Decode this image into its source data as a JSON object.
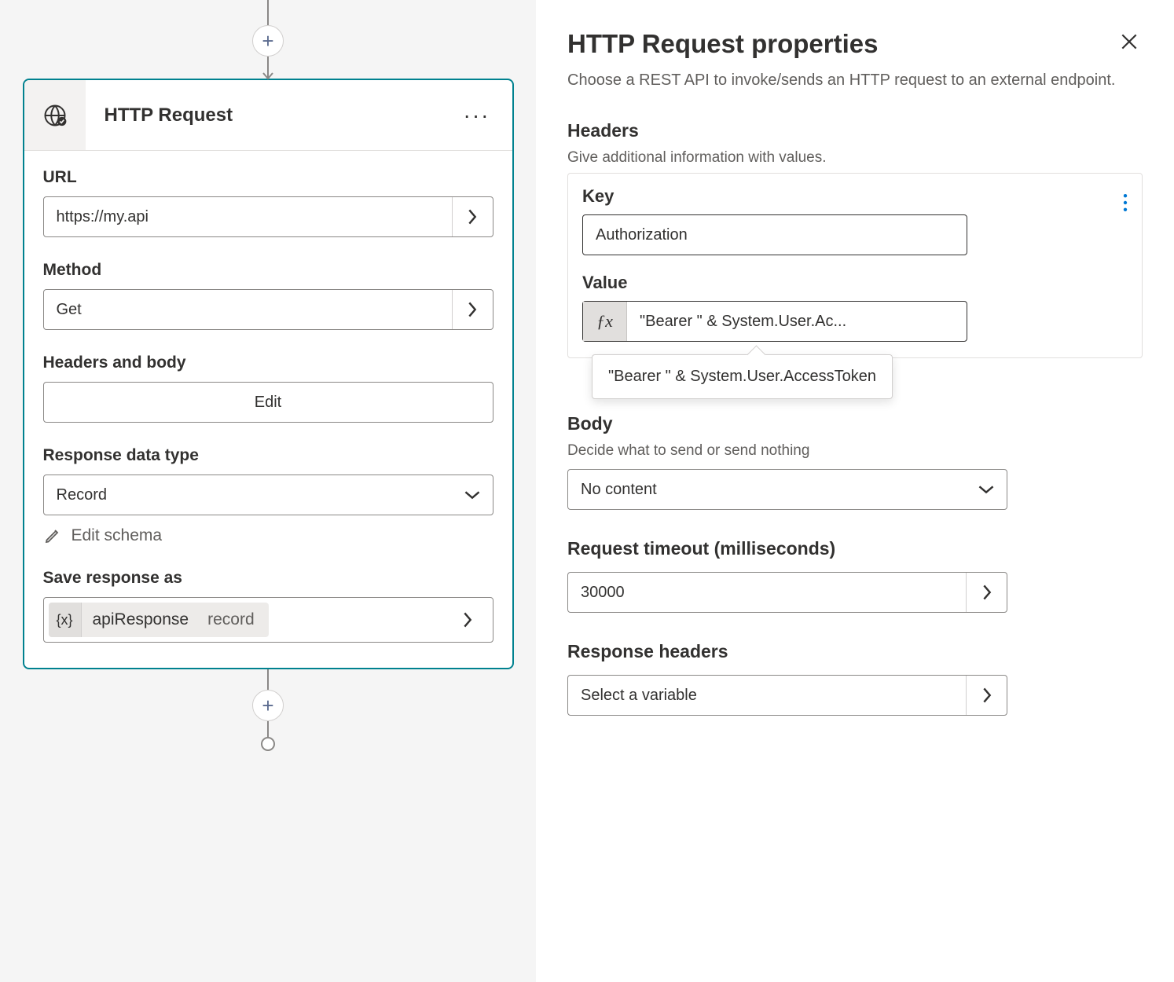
{
  "card": {
    "title": "HTTP Request",
    "url_label": "URL",
    "url_value": "https://my.api",
    "method_label": "Method",
    "method_value": "Get",
    "headers_body_label": "Headers and body",
    "edit_label": "Edit",
    "response_type_label": "Response data type",
    "response_type_value": "Record",
    "edit_schema_label": "Edit schema",
    "save_as_label": "Save response as",
    "save_var_name": "apiResponse",
    "save_var_type": "record",
    "brace_glyph": "{x}"
  },
  "panel": {
    "title": "HTTP Request properties",
    "desc": "Choose a REST API to invoke/sends an HTTP request to an external endpoint.",
    "headers_title": "Headers",
    "headers_desc": "Give additional information with values.",
    "key_label": "Key",
    "key_value": "Authorization",
    "value_label": "Value",
    "fx_label": "ƒx",
    "fx_value_truncated": "\"Bearer \" & System.User.Ac...",
    "fx_tooltip": "\"Bearer \" & System.User.AccessToken",
    "body_title": "Body",
    "body_desc": "Decide what to send or send nothing",
    "body_value": "No content",
    "timeout_title": "Request timeout (milliseconds)",
    "timeout_value": "30000",
    "resp_headers_title": "Response headers",
    "resp_headers_value": "Select a variable"
  }
}
